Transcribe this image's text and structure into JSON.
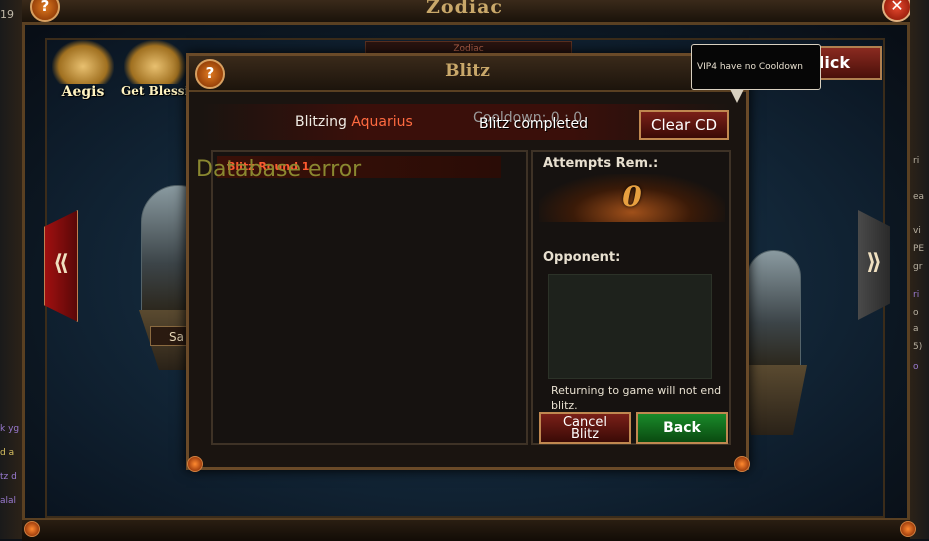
{
  "zodiac": {
    "title": "Zodiac",
    "subtitle": "Zodiac",
    "help_glyph": "?",
    "close_glyph": "✕",
    "one_click_label": "1-Click",
    "features": [
      {
        "label": "Aegis",
        "icon": "aegis-wings-icon"
      },
      {
        "label": "Get Blessi",
        "icon": "blessing-wings-icon"
      }
    ],
    "nav_left_glyph": "⟪",
    "nav_right_glyph": "⟫",
    "stage_label": "Sa",
    "left_edge_texts": [
      "19",
      "k yg",
      "d a",
      "tz d",
      "alal"
    ],
    "right_edge_texts": [
      "ri",
      "ea",
      "vi",
      "PE",
      "gr",
      "ri",
      "o",
      "a",
      "5)",
      "o"
    ]
  },
  "tooltip": {
    "text": "VIP4 have no Cooldown"
  },
  "blitz": {
    "title": "Blitz",
    "help_glyph": "?",
    "status_prefix": "Blitzing ",
    "status_target": "Aquarius",
    "cooldown_text": "Cooldown: 0 : 0",
    "completed_text": "Blitz completed",
    "clear_cd_label": "Clear CD",
    "rounds": [
      "Blitz Round 1"
    ],
    "error_text": "Database error",
    "attempts_label": "Attempts Rem.:",
    "attempts_value": "0",
    "opponent_label": "Opponent:",
    "warning_text": "Returning to game will not end blitz.",
    "cancel_label_line1": "Cancel",
    "cancel_label_line2": "Blitz",
    "back_label": "Back"
  },
  "colors": {
    "accent_gold": "#c9a86a",
    "highlight_red": "#ff6a40",
    "back_green": "#1a8a2a"
  }
}
